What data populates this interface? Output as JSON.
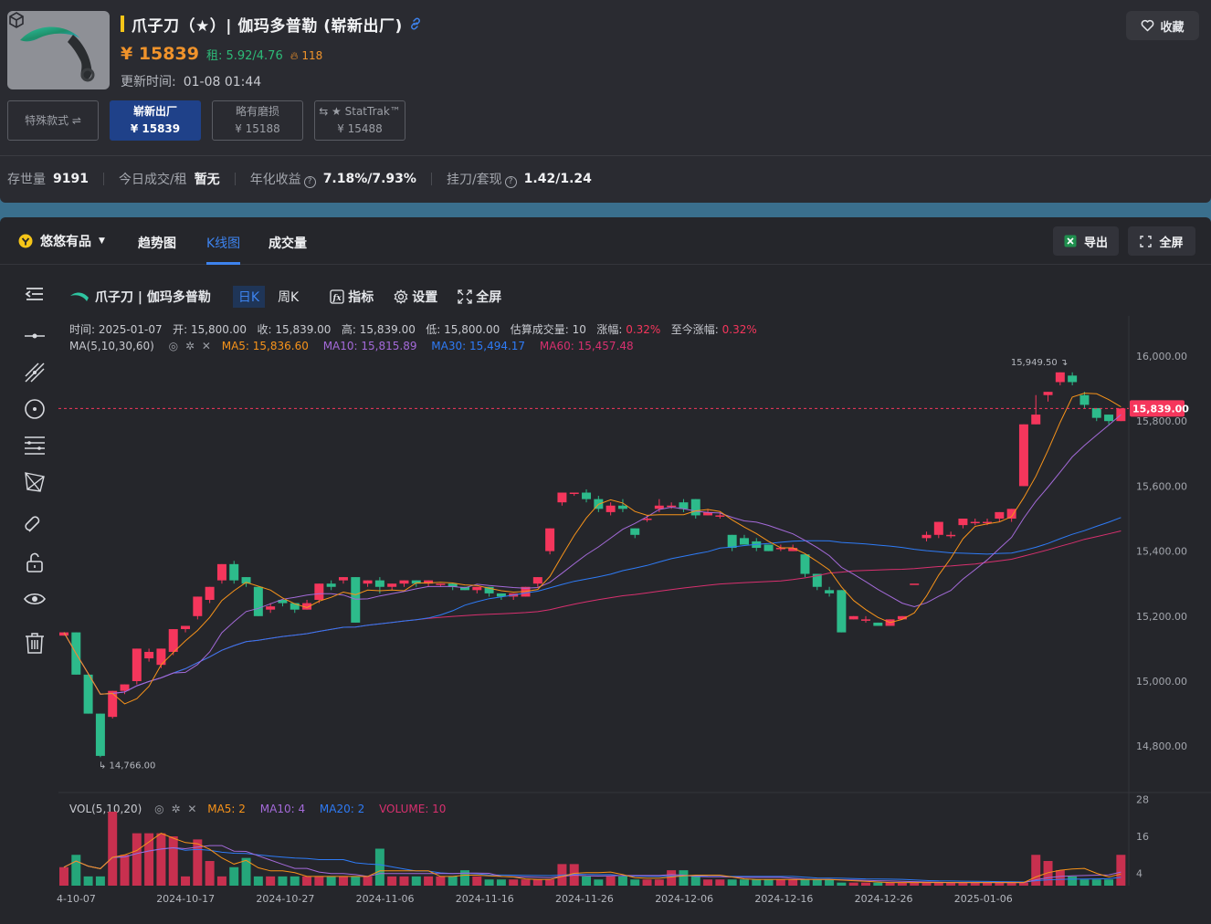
{
  "item": {
    "title": "爪子刀（★）| 伽玛多普勒 (崭新出厂)",
    "price": "¥ 15839",
    "rent": "租: 5.92/4.76",
    "hot": "118",
    "updated_label": "更新时间:",
    "updated_value": "01-08 01:44",
    "favorite_label": "收藏",
    "thumb_icon": "karambit-knife-image",
    "cube_icon": "3d-cube-icon"
  },
  "wear_options": [
    {
      "label": "特殊款式 ⇌",
      "price": ""
    },
    {
      "label": "崭新出厂",
      "price": "¥ 15839"
    },
    {
      "label": "略有磨损",
      "price": "¥ 15188"
    },
    {
      "label": "⇆ ★ StatTrak™",
      "price": "¥ 15488"
    }
  ],
  "stats": [
    {
      "k": "存世量",
      "v": "9191"
    },
    {
      "k": "今日成交/租",
      "v": "暂无"
    },
    {
      "k": "年化收益",
      "v": "7.18%/7.93%"
    },
    {
      "k": "挂刀/套现",
      "v": "1.42/1.24"
    }
  ],
  "tabs": {
    "platform": "悠悠有品",
    "trend": "趋势图",
    "kline": "K线图",
    "volume": "成交量",
    "export": "导出",
    "fullscreen": "全屏"
  },
  "chart_toolbar": {
    "symbol": "爪子刀 | 伽玛多普勒",
    "day": "日K",
    "week": "周K",
    "indicator": "指标",
    "settings": "设置",
    "fullscreen": "全屏"
  },
  "info_line": {
    "time_label": "时间:",
    "time": "2025-01-07",
    "open_label": "开:",
    "open": "15,800.00",
    "close_label": "收:",
    "close": "15,839.00",
    "high_label": "高:",
    "high": "15,839.00",
    "low_label": "低:",
    "low": "15,800.00",
    "vol_label": "估算成交量:",
    "vol": "10",
    "chg_label": "涨幅:",
    "chg": "0.32%",
    "total_label": "至今涨幅:",
    "total": "0.32%"
  },
  "ma_line": {
    "label": "MA(5,10,30,60)",
    "ma5": "MA5: 15,836.60",
    "ma10": "MA10: 15,815.89",
    "ma30": "MA30: 15,494.17",
    "ma60": "MA60: 15,457.48"
  },
  "vol_line": {
    "label": "VOL(5,10,20)",
    "ma5": "MA5: 2",
    "ma10": "MA10: 4",
    "ma20": "MA20: 2",
    "volume": "VOLUME: 10"
  },
  "colors": {
    "up": "#f5365c",
    "down": "#2dbb8b",
    "ma5": "#f7931a",
    "ma10": "#a46ad9",
    "ma30": "#2e7bf6",
    "ma60": "#d8306f"
  },
  "chart_data": {
    "type": "candlestick",
    "y_ticks": [
      "16,000.00",
      "15,800.00",
      "15,600.00",
      "15,400.00",
      "15,200.00",
      "15,000.00",
      "14,800.00"
    ],
    "y_tick_values": [
      16000,
      15800,
      15600,
      15400,
      15200,
      15000,
      14800
    ],
    "ylim": [
      14700,
      16100
    ],
    "vol_ticks": [
      "28",
      "16",
      "4"
    ],
    "vol_tick_values": [
      28,
      16,
      4
    ],
    "x_labels": [
      "4-10-07",
      "2024-10-17",
      "2024-10-27",
      "2024-11-06",
      "2024-11-16",
      "2024-11-26",
      "2024-12-06",
      "2024-12-16",
      "2024-12-26",
      "2025-01-06"
    ],
    "last_price_label": "15,839.00",
    "last_price": 15839,
    "max_label": "15,949.50",
    "max_value": 15949.5,
    "min_label": "14,766.00",
    "min_value": 14766,
    "candles": [
      [
        15140,
        15150,
        15150,
        15140
      ],
      [
        15150,
        15020,
        15150,
        15020
      ],
      [
        15020,
        14900,
        15020,
        14900
      ],
      [
        14900,
        14770,
        14900,
        14766
      ],
      [
        14890,
        14970,
        14970,
        14885
      ],
      [
        14970,
        14990,
        14990,
        14960
      ],
      [
        15000,
        15100,
        15100,
        14990
      ],
      [
        15070,
        15090,
        15100,
        15060
      ],
      [
        15050,
        15100,
        15100,
        15040
      ],
      [
        15090,
        15160,
        15160,
        15080
      ],
      [
        15160,
        15170,
        15170,
        15150
      ],
      [
        15200,
        15260,
        15260,
        15190
      ],
      [
        15250,
        15290,
        15290,
        15240
      ],
      [
        15310,
        15360,
        15360,
        15300
      ],
      [
        15360,
        15310,
        15370,
        15300
      ],
      [
        15320,
        15300,
        15320,
        15290
      ],
      [
        15290,
        15200,
        15290,
        15200
      ],
      [
        15220,
        15230,
        15240,
        15210
      ],
      [
        15250,
        15240,
        15250,
        15230
      ],
      [
        15240,
        15220,
        15240,
        15210
      ],
      [
        15220,
        15240,
        15250,
        15220
      ],
      [
        15250,
        15300,
        15300,
        15240
      ],
      [
        15300,
        15290,
        15310,
        15280
      ],
      [
        15310,
        15320,
        15320,
        15300
      ],
      [
        15320,
        15180,
        15320,
        15180
      ],
      [
        15300,
        15310,
        15310,
        15290
      ],
      [
        15310,
        15290,
        15320,
        15270
      ],
      [
        15290,
        15300,
        15300,
        15280
      ],
      [
        15300,
        15310,
        15310,
        15290
      ],
      [
        15310,
        15300,
        15310,
        15290
      ],
      [
        15300,
        15310,
        15310,
        15290
      ],
      [
        15300,
        15300,
        15300,
        15290
      ],
      [
        15300,
        15290,
        15300,
        15280
      ],
      [
        15290,
        15280,
        15290,
        15280
      ],
      [
        15280,
        15290,
        15290,
        15270
      ],
      [
        15290,
        15270,
        15290,
        15260
      ],
      [
        15270,
        15260,
        15270,
        15250
      ],
      [
        15260,
        15270,
        15270,
        15250
      ],
      [
        15260,
        15290,
        15290,
        15260
      ],
      [
        15300,
        15320,
        15320,
        15290
      ],
      [
        15400,
        15470,
        15470,
        15390
      ],
      [
        15550,
        15580,
        15580,
        15540
      ],
      [
        15580,
        15580,
        15580,
        15570
      ],
      [
        15580,
        15560,
        15590,
        15550
      ],
      [
        15560,
        15530,
        15570,
        15520
      ],
      [
        15520,
        15540,
        15550,
        15510
      ],
      [
        15540,
        15530,
        15560,
        15520
      ],
      [
        15470,
        15450,
        15470,
        15440
      ],
      [
        15500,
        15500,
        15510,
        15490
      ],
      [
        15530,
        15540,
        15560,
        15520
      ],
      [
        15540,
        15540,
        15550,
        15530
      ],
      [
        15550,
        15530,
        15560,
        15520
      ],
      [
        15560,
        15510,
        15560,
        15500
      ],
      [
        15510,
        15520,
        15530,
        15510
      ],
      [
        15510,
        15510,
        15520,
        15500
      ],
      [
        15450,
        15410,
        15450,
        15400
      ],
      [
        15440,
        15420,
        15450,
        15420
      ],
      [
        15430,
        15410,
        15440,
        15400
      ],
      [
        15420,
        15400,
        15420,
        15400
      ],
      [
        15410,
        15410,
        15420,
        15400
      ],
      [
        15400,
        15410,
        15420,
        15400
      ],
      [
        15390,
        15330,
        15390,
        15320
      ],
      [
        15330,
        15290,
        15330,
        15280
      ],
      [
        15280,
        15270,
        15290,
        15260
      ],
      [
        15280,
        15150,
        15280,
        15150
      ],
      [
        15190,
        15200,
        15200,
        15190
      ],
      [
        15190,
        15190,
        15200,
        15180
      ],
      [
        15180,
        15170,
        15180,
        15170
      ],
      [
        15170,
        15190,
        15190,
        15170
      ],
      [
        15190,
        15200,
        15200,
        15190
      ],
      [
        15300,
        15300,
        15300,
        15300
      ],
      [
        15440,
        15450,
        15460,
        15430
      ],
      [
        15450,
        15490,
        15490,
        15440
      ],
      [
        15450,
        15450,
        15460,
        15440
      ],
      [
        15480,
        15500,
        15500,
        15470
      ],
      [
        15490,
        15490,
        15500,
        15480
      ],
      [
        15490,
        15490,
        15500,
        15480
      ],
      [
        15500,
        15520,
        15520,
        15490
      ],
      [
        15500,
        15530,
        15530,
        15490
      ],
      [
        15600,
        15790,
        15790,
        15600
      ],
      [
        15790,
        15820,
        15880,
        15790
      ],
      [
        15880,
        15890,
        15890,
        15860
      ],
      [
        15920,
        15950,
        15950,
        15910
      ],
      [
        15940,
        15920,
        15950,
        15910
      ],
      [
        15880,
        15850,
        15890,
        15840
      ],
      [
        15840,
        15810,
        15840,
        15800
      ],
      [
        15820,
        15800,
        15820,
        15790
      ],
      [
        15800,
        15839,
        15839,
        15800
      ]
    ],
    "volumes": [
      6,
      10,
      3,
      3,
      24,
      10,
      17,
      17,
      17,
      16,
      3,
      15,
      8,
      3,
      6,
      9,
      3,
      3,
      3,
      3,
      3,
      3,
      3,
      3,
      3,
      3,
      12,
      3,
      3,
      3,
      3,
      3,
      3,
      5,
      3,
      2,
      2,
      2,
      2,
      2,
      2,
      7,
      7,
      3,
      2,
      3,
      3,
      2,
      2,
      2,
      5,
      5,
      3,
      2,
      2,
      2,
      2,
      2,
      2,
      2,
      2,
      2,
      2,
      2,
      1,
      1,
      1,
      1,
      1,
      1,
      1,
      1,
      1,
      1,
      1,
      1,
      1,
      1,
      1,
      1,
      10,
      8,
      5,
      3,
      2,
      2,
      2,
      10
    ]
  }
}
